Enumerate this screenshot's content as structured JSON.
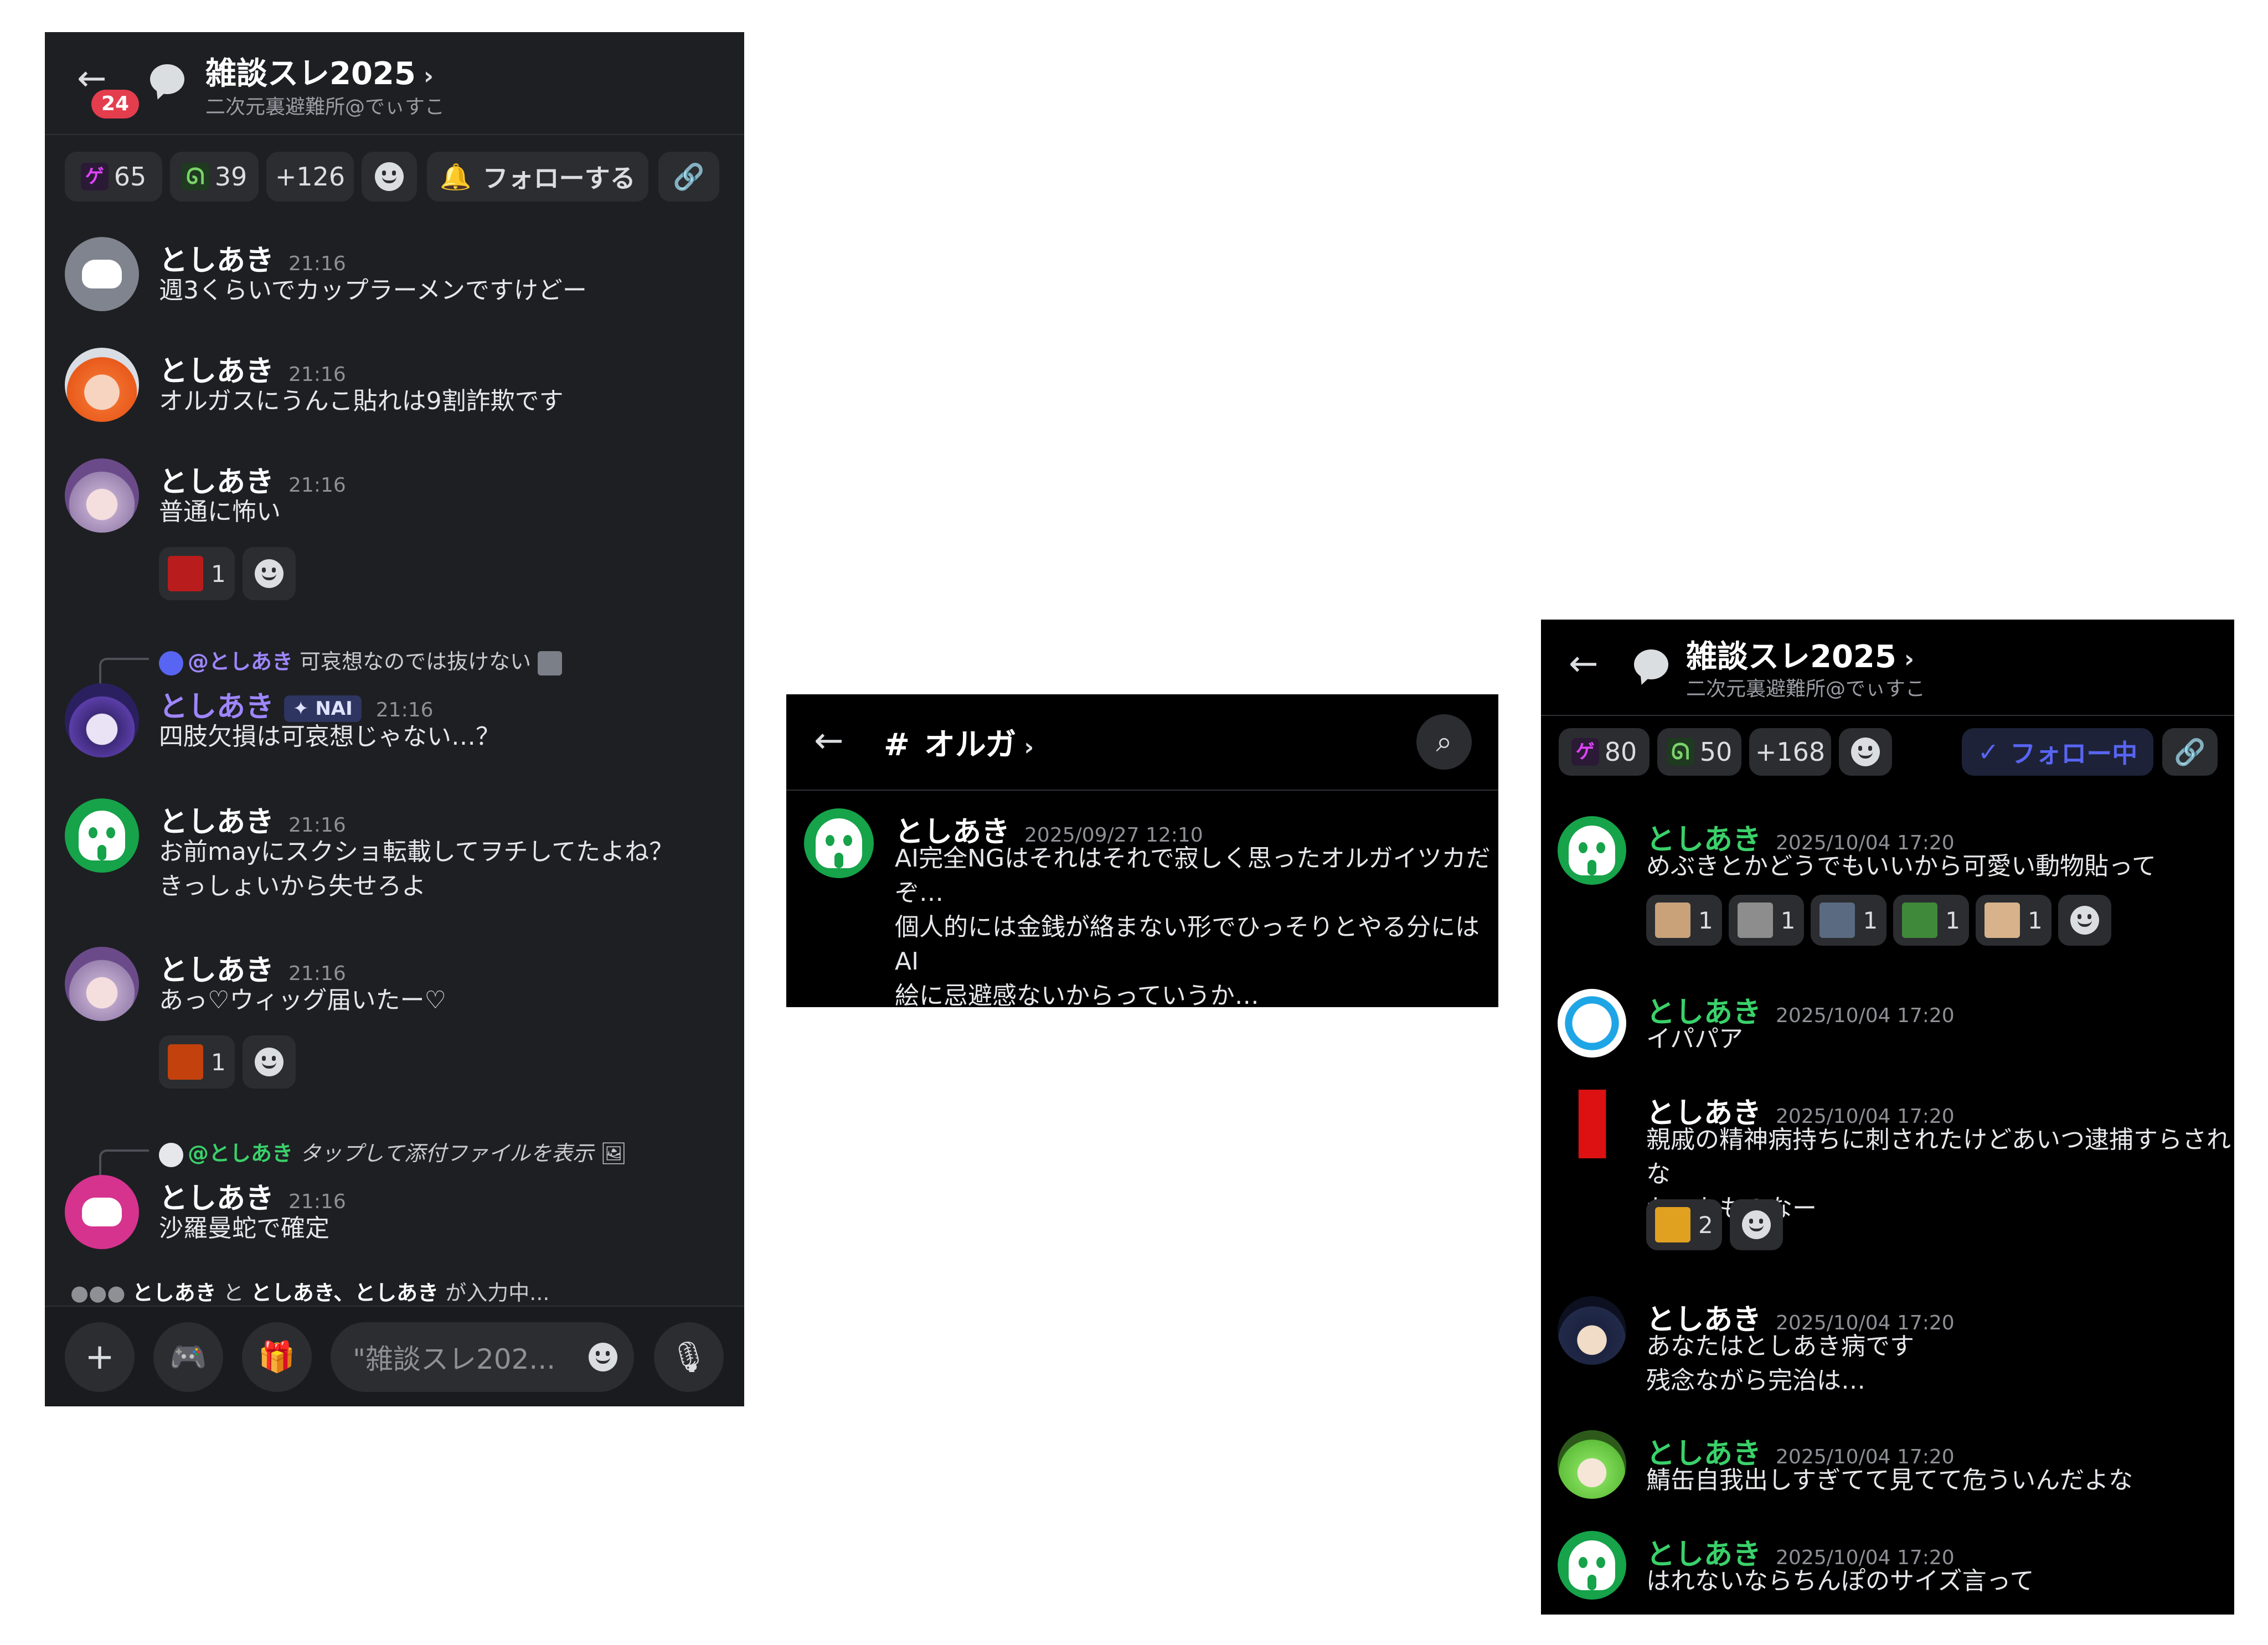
{
  "panel1": {
    "title": "雑談スレ2025",
    "subtitle": "二次元裏避難所@でぃすこ",
    "unread_badge": "24",
    "reactions_bar": [
      {
        "emoji": "gay-emoji",
        "count": "65"
      },
      {
        "emoji": "snake-emoji",
        "count": "39"
      },
      {
        "label": "+126"
      }
    ],
    "follow_label": "フォローする",
    "messages": [
      {
        "author": "としあき",
        "time": "21:16",
        "text": "週3くらいでカップラーメンですけどー"
      },
      {
        "author": "としあき",
        "time": "21:16",
        "text": "オルガスにうんこ貼れは9割詐欺です"
      },
      {
        "author": "としあき",
        "time": "21:16",
        "text": "普通に怖い",
        "reaction": {
          "emoji": "sodane-emoji",
          "count": "1"
        }
      },
      {
        "reply_mention": "@としあき",
        "reply_text": "可哀想なのでは抜けない",
        "author": "としあき",
        "tag": "NAI",
        "time": "21:16",
        "text": "四肢欠損は可哀想じゃない…？"
      },
      {
        "author": "としあき",
        "time": "21:16",
        "text_lines": [
          "お前mayにスクショ転載してヲチしてたよね？",
          "きっしょいから失せろよ"
        ]
      },
      {
        "author": "としあき",
        "time": "21:16",
        "text": "あっ♡ウィッグ届いたー♡",
        "reaction": {
          "emoji": "suteki-emoji",
          "count": "1"
        }
      },
      {
        "reply_mention": "@としあき",
        "reply_text": "タップして添付ファイルを表示",
        "author": "としあき",
        "time": "21:16",
        "text": "沙羅曼蛇で確定"
      }
    ],
    "typing": {
      "name1": "としあき",
      "conj": "と",
      "name2": "としあき、としあき",
      "suffix": "が入力中..."
    },
    "composer_placeholder": "\"雑談スレ202..."
  },
  "panel2": {
    "channel": "オルガ",
    "message": {
      "author": "としあき",
      "time": "2025/09/27 12:10",
      "text_lines": [
        "AI完全NGはそれはそれで寂しく思ったオルガイツカだ",
        "ぞ…",
        "個人的には金銭が絡まない形でひっそりとやる分にはAI",
        "絵に忌避感ないからっていうか…"
      ]
    }
  },
  "panel3": {
    "title": "雑談スレ2025",
    "subtitle": "二次元裏避難所@でぃすこ",
    "reactions_bar": [
      {
        "emoji": "gay-emoji",
        "count": "80"
      },
      {
        "emoji": "snake-emoji",
        "count": "50"
      },
      {
        "label": "+168"
      }
    ],
    "follow_label": "フォロー中",
    "messages": [
      {
        "author": "としあき",
        "time": "2025/10/04 17:20",
        "text": "めぶきとかどうでもいいから可愛い動物貼って",
        "reactions": [
          "1",
          "1",
          "1",
          "1",
          "1"
        ]
      },
      {
        "author": "としあき",
        "time": "2025/10/04 17:20",
        "text": "イパパア"
      },
      {
        "author": "としあき",
        "time": "2025/10/04 17:20",
        "text_lines": [
          "親戚の精神病持ちに刺されたけどあいつ逮捕すらされな",
          "かったものなー"
        ],
        "reaction_count": "2"
      },
      {
        "author": "としあき",
        "time": "2025/10/04 17:20",
        "text_lines": [
          "あなたはとしあき病です",
          "残念ながら完治は…"
        ]
      },
      {
        "author": "としあき",
        "time": "2025/10/04 17:20",
        "text": "鯖缶自我出しすぎてて見てて危ういんだよな"
      },
      {
        "author": "としあき",
        "time": "2025/10/04 17:20",
        "text": "はれないならちんぽのサイズ言って"
      }
    ]
  },
  "colors": {
    "accent_green": "#3ad16a",
    "accent_purple": "#9e86ff",
    "badge_red": "#e33d4e",
    "follow_blue": "#5865f2"
  }
}
